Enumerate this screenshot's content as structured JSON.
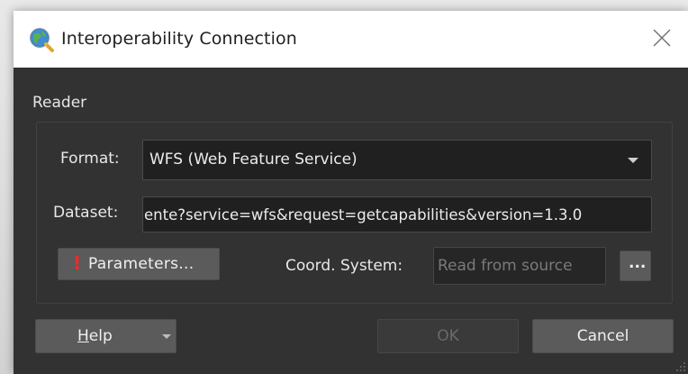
{
  "window": {
    "title": "Interoperability Connection"
  },
  "reader": {
    "section_label": "Reader",
    "format_label": "Format:",
    "format_value": "WFS (Web Feature Service)",
    "dataset_label": "Dataset:",
    "dataset_value": "ente?service=wfs&request=getcapabilities&version=1.3.0",
    "parameters_label": "Parameters...",
    "parameters_warning": "!",
    "coord_label": "Coord. System:",
    "coord_placeholder": "Read from source",
    "browse_label": "..."
  },
  "footer": {
    "help_label": "Help",
    "ok_label": "OK",
    "cancel_label": "Cancel"
  },
  "icons": {
    "app": "globe-magnifier-icon",
    "close": "close-icon",
    "dropdown": "chevron-down-icon",
    "warning": "exclamation-icon",
    "grip": "resize-grip-icon"
  },
  "colors": {
    "dialog_bg": "#323232",
    "titlebar_bg": "#ffffff",
    "button_bg": "#5b5b5b",
    "warning": "#ee2b2b"
  }
}
